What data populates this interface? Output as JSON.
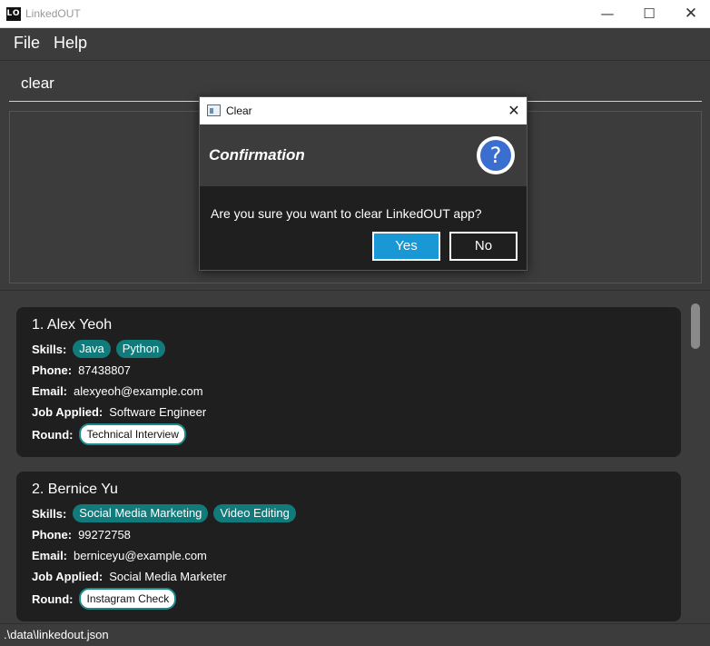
{
  "window": {
    "logo_text": "LO",
    "title": "LinkedOUT",
    "minimize_glyph": "—",
    "maximize_glyph": "☐",
    "close_glyph": "✕"
  },
  "menu": {
    "file": "File",
    "help": "Help"
  },
  "command": {
    "value": "clear"
  },
  "applicants": [
    {
      "index_name": "1.  Alex Yeoh",
      "skills_label": "Skills:",
      "skills": [
        "Java",
        "Python"
      ],
      "phone_label": "Phone:",
      "phone": "87438807",
      "email_label": "Email:",
      "email": "alexyeoh@example.com",
      "job_label": "Job Applied:",
      "job": "Software Engineer",
      "round_label": "Round:",
      "round": "Technical Interview"
    },
    {
      "index_name": "2.  Bernice Yu",
      "skills_label": "Skills:",
      "skills": [
        "Social Media Marketing",
        "Video Editing"
      ],
      "phone_label": "Phone:",
      "phone": "99272758",
      "email_label": "Email:",
      "email": "berniceyu@example.com",
      "job_label": "Job Applied:",
      "job": "Social Media Marketer",
      "round_label": "Round:",
      "round": "Instagram Check"
    }
  ],
  "status": {
    "file_path": ".\\data\\linkedout.json"
  },
  "dialog": {
    "title": "Clear",
    "close_glyph": "✕",
    "heading": "Confirmation",
    "help_glyph": "?",
    "message": "Are you sure you want to clear LinkedOUT app?",
    "yes_label": "Yes",
    "no_label": "No"
  },
  "colors": {
    "background": "#3c3c3c",
    "card": "#1f1f1f",
    "skill_tag": "#117a7a",
    "yes_button": "#1a97d5",
    "help_icon": "#3a6fd0"
  }
}
